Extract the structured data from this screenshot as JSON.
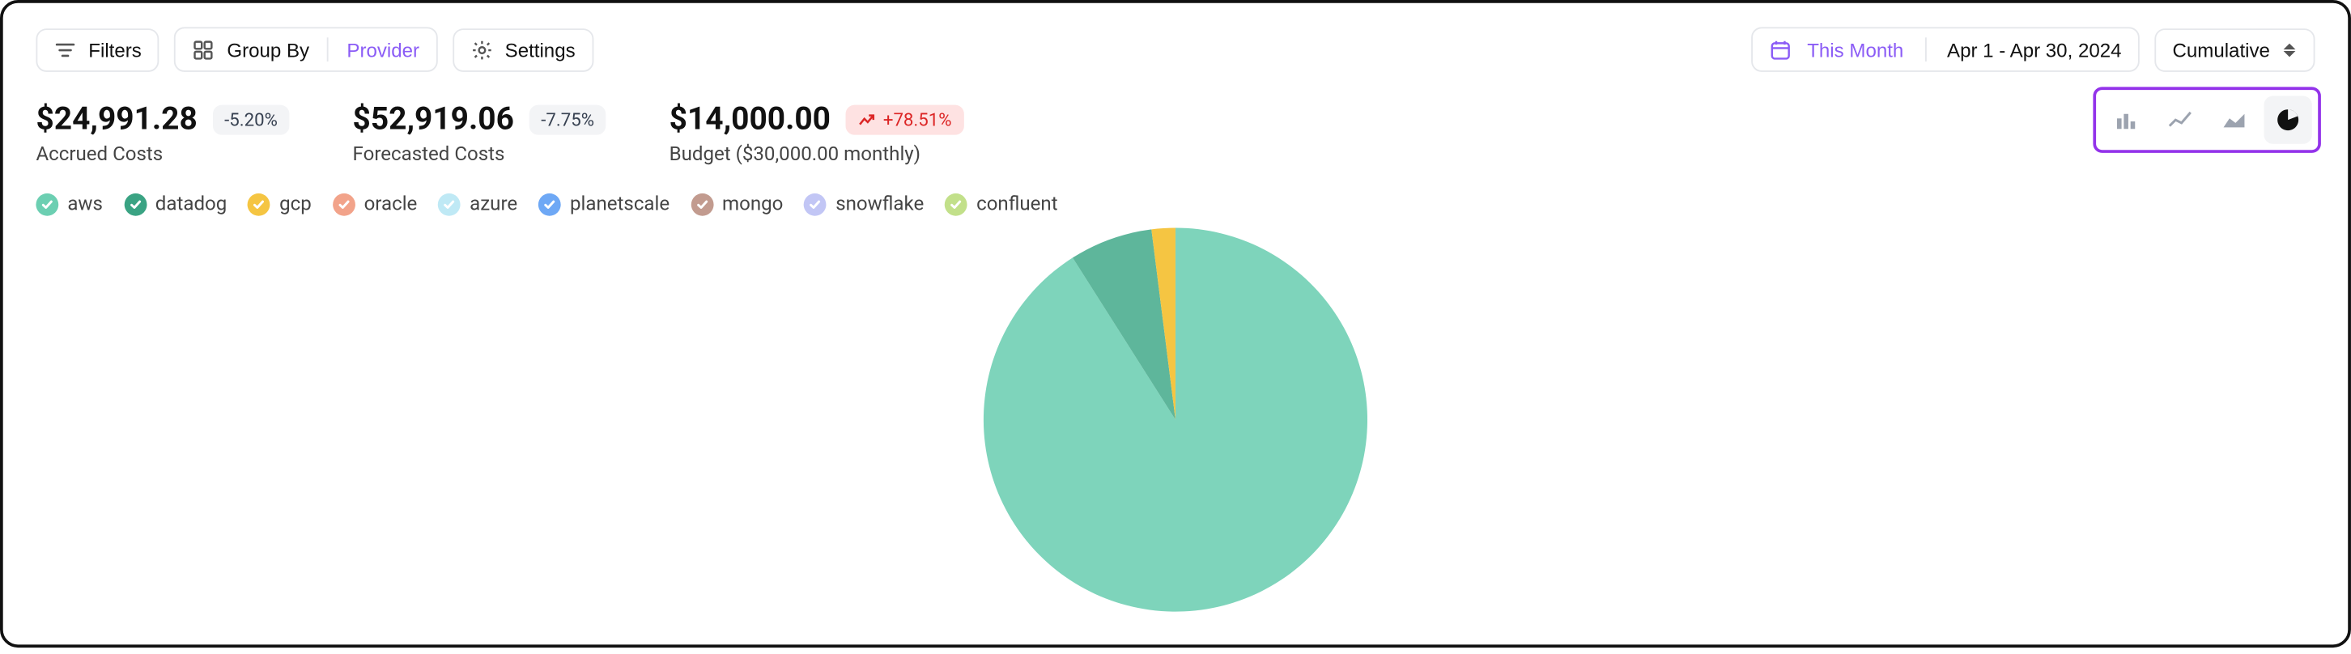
{
  "toolbar": {
    "filters_label": "Filters",
    "groupby_label": "Group By",
    "groupby_value": "Provider",
    "settings_label": "Settings",
    "date_preset": "This Month",
    "date_range": "Apr 1 - Apr 30, 2024",
    "view_mode": "Cumulative"
  },
  "stats": {
    "accrued": {
      "value": "$24,991.28",
      "delta": "-5.20%",
      "label": "Accrued Costs"
    },
    "forecast": {
      "value": "$52,919.06",
      "delta": "-7.75%",
      "label": "Forecasted Costs"
    },
    "budget": {
      "value": "$14,000.00",
      "delta": "+78.51%",
      "label": "Budget ($30,000.00 monthly)"
    }
  },
  "legend": [
    {
      "name": "aws",
      "color": "#6ccfb2"
    },
    {
      "name": "datadog",
      "color": "#3aa383"
    },
    {
      "name": "gcp",
      "color": "#f5c542"
    },
    {
      "name": "oracle",
      "color": "#f2a38a"
    },
    {
      "name": "azure",
      "color": "#bfe9f5"
    },
    {
      "name": "planetscale",
      "color": "#6ea8f5"
    },
    {
      "name": "mongo",
      "color": "#c29b8f"
    },
    {
      "name": "snowflake",
      "color": "#c2c6f5"
    },
    {
      "name": "confluent",
      "color": "#c2e08a"
    }
  ],
  "chart_types": {
    "options": [
      "bar",
      "line",
      "area",
      "pie"
    ],
    "active": "pie"
  },
  "chart_data": {
    "type": "pie",
    "title": "",
    "categories": [
      "aws",
      "datadog",
      "gcp"
    ],
    "values": [
      91,
      7,
      2
    ],
    "colors": [
      "#7ed4bb",
      "#5eb69b",
      "#f5c542"
    ],
    "unit": "percent",
    "note": "Remaining providers (oracle, azure, planetscale, mongo, snowflake, confluent) not visible as slices"
  }
}
